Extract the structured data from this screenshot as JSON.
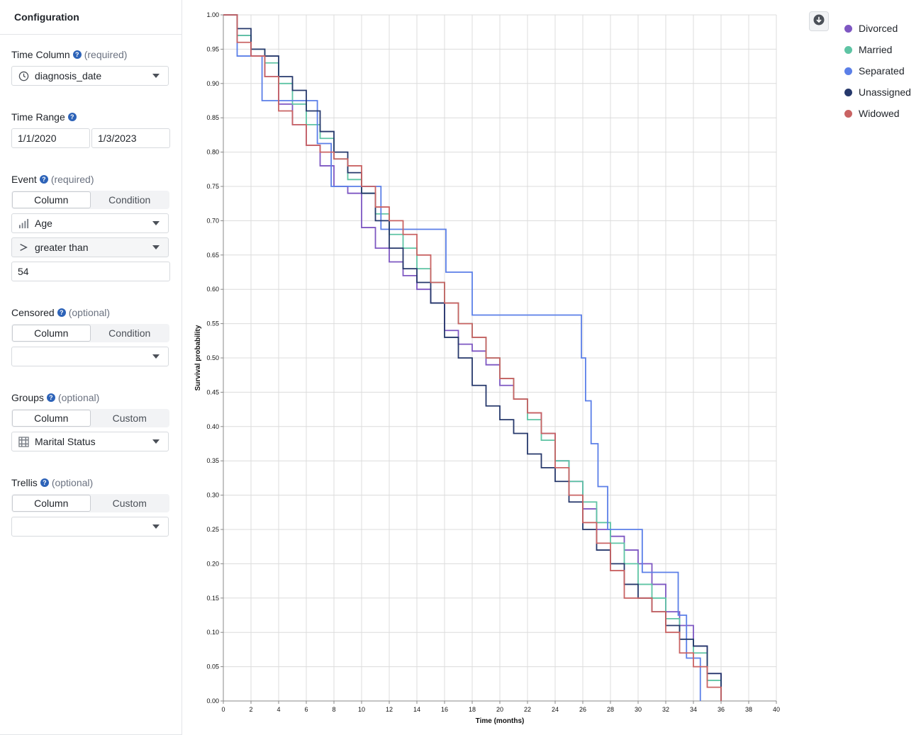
{
  "config": {
    "title": "Configuration",
    "time_column": {
      "label": "Time Column",
      "hint": "(required)",
      "value": "diagnosis_date",
      "icon": "clock-icon"
    },
    "time_range": {
      "label": "Time Range",
      "start": "1/1/2020",
      "end": "1/3/2023"
    },
    "event": {
      "label": "Event",
      "hint": "(required)",
      "tabs": [
        "Column",
        "Condition"
      ],
      "active_tab": "Column",
      "column_value": "Age",
      "column_icon": "numeric-bars-icon",
      "operator_value": "greater than",
      "operator_icon": "greater-than-icon",
      "threshold_value": "54"
    },
    "censored": {
      "label": "Censored",
      "hint": "(optional)",
      "tabs": [
        "Column",
        "Condition"
      ],
      "active_tab": "Column",
      "value": ""
    },
    "groups": {
      "label": "Groups",
      "hint": "(optional)",
      "tabs": [
        "Column",
        "Custom"
      ],
      "active_tab": "Column",
      "value": "Marital Status",
      "icon": "grid-icon"
    },
    "trellis": {
      "label": "Trellis",
      "hint": "(optional)",
      "tabs": [
        "Column",
        "Custom"
      ],
      "active_tab": "Column",
      "value": ""
    }
  },
  "chart": {
    "download_icon": "download-icon"
  },
  "chart_data": {
    "type": "line",
    "step": true,
    "xlabel": "Time (months)",
    "ylabel": "Survival probability",
    "xlim": [
      0,
      40
    ],
    "ylim": [
      0,
      1
    ],
    "xticks": [
      "0",
      "2",
      "4",
      "6",
      "8",
      "10",
      "12",
      "14",
      "16",
      "18",
      "20",
      "22",
      "24",
      "26",
      "28",
      "30",
      "32",
      "34",
      "36",
      "38",
      "40"
    ],
    "yticks": [
      "0.00",
      "0.05",
      "0.10",
      "0.15",
      "0.20",
      "0.25",
      "0.30",
      "0.35",
      "0.40",
      "0.45",
      "0.50",
      "0.55",
      "0.60",
      "0.65",
      "0.70",
      "0.75",
      "0.80",
      "0.85",
      "0.90",
      "0.95",
      "1.00"
    ],
    "grid": true,
    "legend_position": "top-right",
    "series": [
      {
        "name": "Divorced",
        "color": "#7e57c2",
        "points": [
          [
            0,
            1.0
          ],
          [
            1,
            0.97
          ],
          [
            2,
            0.94
          ],
          [
            3,
            0.91
          ],
          [
            4,
            0.87
          ],
          [
            5,
            0.84
          ],
          [
            6,
            0.81
          ],
          [
            7,
            0.78
          ],
          [
            8,
            0.75
          ],
          [
            9,
            0.74
          ],
          [
            10,
            0.69
          ],
          [
            11,
            0.66
          ],
          [
            12,
            0.64
          ],
          [
            13,
            0.62
          ],
          [
            14,
            0.6
          ],
          [
            15,
            0.58
          ],
          [
            16,
            0.54
          ],
          [
            17,
            0.52
          ],
          [
            18,
            0.51
          ],
          [
            19,
            0.49
          ],
          [
            20,
            0.46
          ],
          [
            21,
            0.44
          ],
          [
            22,
            0.42
          ],
          [
            23,
            0.39
          ],
          [
            24,
            0.35
          ],
          [
            25,
            0.32
          ],
          [
            26,
            0.28
          ],
          [
            27,
            0.25
          ],
          [
            28,
            0.24
          ],
          [
            29,
            0.22
          ],
          [
            30,
            0.2
          ],
          [
            31,
            0.17
          ],
          [
            32,
            0.13
          ],
          [
            33,
            0.11
          ],
          [
            34,
            0.08
          ],
          [
            35,
            0.04
          ],
          [
            36,
            0.0
          ]
        ]
      },
      {
        "name": "Married",
        "color": "#5ec4a4",
        "points": [
          [
            0,
            1.0
          ],
          [
            1,
            0.97
          ],
          [
            2,
            0.95
          ],
          [
            3,
            0.93
          ],
          [
            4,
            0.9
          ],
          [
            5,
            0.87
          ],
          [
            6,
            0.84
          ],
          [
            7,
            0.82
          ],
          [
            8,
            0.79
          ],
          [
            9,
            0.76
          ],
          [
            10,
            0.74
          ],
          [
            11,
            0.71
          ],
          [
            12,
            0.68
          ],
          [
            13,
            0.66
          ],
          [
            14,
            0.63
          ],
          [
            15,
            0.61
          ],
          [
            16,
            0.58
          ],
          [
            17,
            0.55
          ],
          [
            18,
            0.53
          ],
          [
            19,
            0.5
          ],
          [
            20,
            0.47
          ],
          [
            21,
            0.44
          ],
          [
            22,
            0.41
          ],
          [
            23,
            0.38
          ],
          [
            24,
            0.35
          ],
          [
            25,
            0.32
          ],
          [
            26,
            0.29
          ],
          [
            27,
            0.26
          ],
          [
            28,
            0.23
          ],
          [
            29,
            0.2
          ],
          [
            30,
            0.17
          ],
          [
            31,
            0.15
          ],
          [
            32,
            0.12
          ],
          [
            33,
            0.09
          ],
          [
            34,
            0.07
          ],
          [
            35,
            0.03
          ],
          [
            36,
            0.0
          ]
        ]
      },
      {
        "name": "Separated",
        "color": "#5b7fe8",
        "points": [
          [
            0,
            1.0
          ],
          [
            1,
            0.94
          ],
          [
            2,
            0.94
          ],
          [
            2.8,
            0.875
          ],
          [
            3,
            0.875
          ],
          [
            6.8,
            0.875
          ],
          [
            6.8,
            0.8125
          ],
          [
            7.8,
            0.8125
          ],
          [
            7.8,
            0.75
          ],
          [
            11.4,
            0.75
          ],
          [
            11.4,
            0.6875
          ],
          [
            16.1,
            0.6875
          ],
          [
            16.1,
            0.625
          ],
          [
            18,
            0.625
          ],
          [
            18,
            0.5625
          ],
          [
            25.9,
            0.5625
          ],
          [
            25.9,
            0.5
          ],
          [
            26.2,
            0.5
          ],
          [
            26.2,
            0.4375
          ],
          [
            26.6,
            0.4375
          ],
          [
            26.6,
            0.375
          ],
          [
            27.1,
            0.375
          ],
          [
            27.1,
            0.3125
          ],
          [
            27.8,
            0.3125
          ],
          [
            27.8,
            0.25
          ],
          [
            30.3,
            0.25
          ],
          [
            30.3,
            0.1875
          ],
          [
            32.9,
            0.1875
          ],
          [
            32.9,
            0.125
          ],
          [
            33.5,
            0.125
          ],
          [
            33.5,
            0.0625
          ],
          [
            34.5,
            0.0625
          ],
          [
            34.5,
            0.0
          ]
        ]
      },
      {
        "name": "Unassigned",
        "color": "#26386b",
        "points": [
          [
            0,
            1.0
          ],
          [
            1,
            0.98
          ],
          [
            2,
            0.95
          ],
          [
            3,
            0.94
          ],
          [
            4,
            0.91
          ],
          [
            5,
            0.89
          ],
          [
            6,
            0.86
          ],
          [
            7,
            0.83
          ],
          [
            8,
            0.8
          ],
          [
            9,
            0.77
          ],
          [
            10,
            0.74
          ],
          [
            11,
            0.7
          ],
          [
            12,
            0.66
          ],
          [
            13,
            0.63
          ],
          [
            14,
            0.61
          ],
          [
            15,
            0.58
          ],
          [
            16,
            0.53
          ],
          [
            17,
            0.5
          ],
          [
            18,
            0.46
          ],
          [
            19,
            0.43
          ],
          [
            20,
            0.41
          ],
          [
            21,
            0.39
          ],
          [
            22,
            0.36
          ],
          [
            23,
            0.34
          ],
          [
            24,
            0.32
          ],
          [
            25,
            0.29
          ],
          [
            26,
            0.25
          ],
          [
            27,
            0.22
          ],
          [
            28,
            0.2
          ],
          [
            29,
            0.17
          ],
          [
            30,
            0.15
          ],
          [
            31,
            0.13
          ],
          [
            32,
            0.11
          ],
          [
            33,
            0.09
          ],
          [
            34,
            0.08
          ],
          [
            35,
            0.04
          ],
          [
            36,
            0.0
          ]
        ]
      },
      {
        "name": "Widowed",
        "color": "#c96363",
        "points": [
          [
            0,
            1.0
          ],
          [
            1,
            0.96
          ],
          [
            2,
            0.94
          ],
          [
            3,
            0.91
          ],
          [
            4,
            0.86
          ],
          [
            5,
            0.84
          ],
          [
            6,
            0.81
          ],
          [
            7,
            0.8
          ],
          [
            8,
            0.79
          ],
          [
            9,
            0.78
          ],
          [
            10,
            0.75
          ],
          [
            11,
            0.72
          ],
          [
            12,
            0.7
          ],
          [
            13,
            0.68
          ],
          [
            14,
            0.65
          ],
          [
            15,
            0.61
          ],
          [
            16,
            0.58
          ],
          [
            17,
            0.55
          ],
          [
            18,
            0.53
          ],
          [
            19,
            0.5
          ],
          [
            20,
            0.47
          ],
          [
            21,
            0.44
          ],
          [
            22,
            0.42
          ],
          [
            23,
            0.39
          ],
          [
            24,
            0.34
          ],
          [
            25,
            0.3
          ],
          [
            26,
            0.26
          ],
          [
            27,
            0.23
          ],
          [
            28,
            0.19
          ],
          [
            29,
            0.15
          ],
          [
            30,
            0.15
          ],
          [
            31,
            0.13
          ],
          [
            32,
            0.1
          ],
          [
            33,
            0.07
          ],
          [
            34,
            0.05
          ],
          [
            35,
            0.02
          ],
          [
            36,
            0.0
          ]
        ]
      }
    ]
  }
}
